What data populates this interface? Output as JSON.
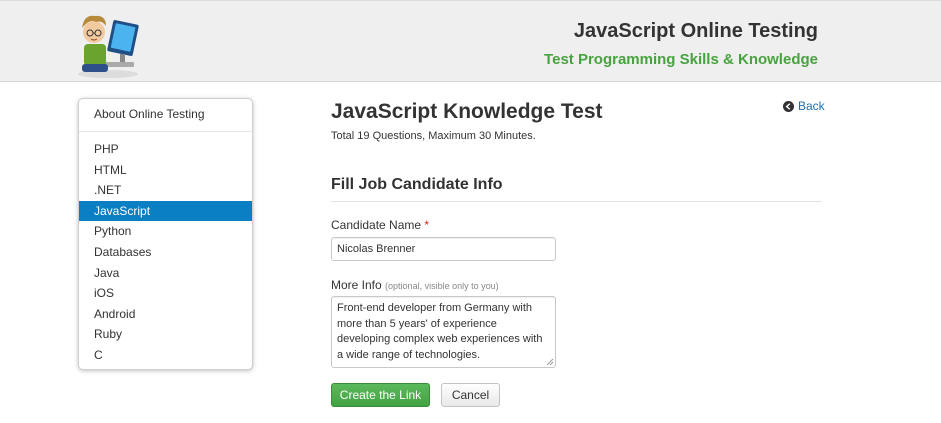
{
  "header": {
    "title": "JavaScript Online Testing",
    "subtitle": "Test Programming Skills & Knowledge",
    "accent_color": "#48a23f"
  },
  "sidebar": {
    "about_label": "About Online Testing",
    "active_color": "#0a7fc4",
    "items": [
      {
        "label": "PHP",
        "active": false
      },
      {
        "label": "HTML",
        "active": false
      },
      {
        "label": ".NET",
        "active": false
      },
      {
        "label": "JavaScript",
        "active": true
      },
      {
        "label": "Python",
        "active": false
      },
      {
        "label": "Databases",
        "active": false
      },
      {
        "label": "Java",
        "active": false
      },
      {
        "label": "iOS",
        "active": false
      },
      {
        "label": "Android",
        "active": false
      },
      {
        "label": "Ruby",
        "active": false
      },
      {
        "label": "C",
        "active": false
      }
    ]
  },
  "main": {
    "title": "JavaScript Knowledge Test",
    "subtitle": "Total 19 Questions, Maximum 30 Minutes.",
    "back_label": "Back",
    "section_title": "Fill Job Candidate Info",
    "form": {
      "name_label": "Candidate Name",
      "required_mark": "*",
      "name_value": "Nicolas Brenner",
      "info_label": "More Info",
      "info_hint": "(optional, visible only to you)",
      "info_value": "Front-end developer from Germany with more than 5 years' of experience developing complex web experiences with a wide range of technologies.",
      "create_label": "Create the Link",
      "cancel_label": "Cancel"
    }
  }
}
